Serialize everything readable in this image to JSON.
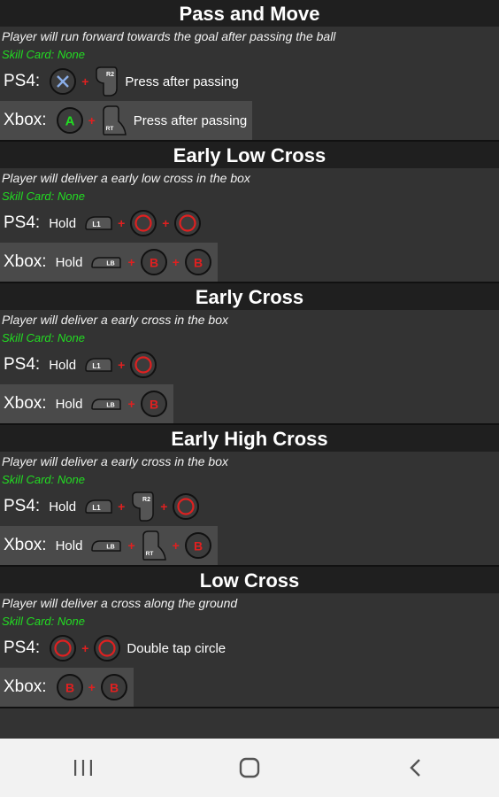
{
  "colors": {
    "accent_red": "#e02020",
    "skill_green": "#22dd22",
    "header_bg": "#1f1f1f",
    "body_bg": "#333333",
    "xbox_row_bg": "#4a4a4a"
  },
  "sections": [
    {
      "title": "Pass and Move",
      "description": "Player will run forward towards the goal after passing the ball",
      "skill": "Skill Card: None",
      "ps4": {
        "label": "PS4:",
        "hold": "",
        "buttons": [
          "cross-icon",
          "r2-trigger-icon"
        ],
        "text": "Press after passing"
      },
      "xbox": {
        "label": "Xbox:",
        "hold": "",
        "buttons": [
          "a-button-icon",
          "rt-trigger-icon"
        ],
        "text": "Press after passing"
      }
    },
    {
      "title": "Early Low Cross",
      "description": "Player will deliver a early low cross in the box",
      "skill": "Skill Card: None",
      "ps4": {
        "label": "PS4:",
        "hold": "Hold",
        "buttons": [
          "l1-bumper-icon",
          "circle-icon",
          "circle-icon"
        ],
        "text": ""
      },
      "xbox": {
        "label": "Xbox:",
        "hold": "Hold",
        "buttons": [
          "lb-bumper-icon",
          "b-button-icon",
          "b-button-icon"
        ],
        "text": ""
      }
    },
    {
      "title": "Early Cross",
      "description": "Player will deliver a early cross in the box",
      "skill": "Skill Card: None",
      "ps4": {
        "label": "PS4:",
        "hold": "Hold",
        "buttons": [
          "l1-bumper-icon",
          "circle-icon"
        ],
        "text": ""
      },
      "xbox": {
        "label": "Xbox:",
        "hold": "Hold",
        "buttons": [
          "lb-bumper-icon",
          "b-button-icon"
        ],
        "text": ""
      }
    },
    {
      "title": "Early High Cross",
      "description": "Player will deliver a early cross in the box",
      "skill": "Skill Card: None",
      "ps4": {
        "label": "PS4:",
        "hold": "Hold",
        "buttons": [
          "l1-bumper-icon",
          "r2-trigger-icon",
          "circle-icon"
        ],
        "text": ""
      },
      "xbox": {
        "label": "Xbox:",
        "hold": "Hold",
        "buttons": [
          "lb-bumper-icon",
          "rt-trigger-icon",
          "b-button-icon"
        ],
        "text": ""
      }
    },
    {
      "title": "Low Cross",
      "description": "Player will deliver a cross along the ground",
      "skill": "Skill Card: None",
      "ps4": {
        "label": "PS4:",
        "hold": "",
        "buttons": [
          "circle-icon",
          "circle-icon"
        ],
        "text": "Double tap circle"
      },
      "xbox": {
        "label": "Xbox:",
        "hold": "",
        "buttons": [
          "b-button-icon",
          "b-button-icon"
        ],
        "text": ""
      }
    }
  ],
  "navbar": {
    "buttons": [
      "recent-apps-icon",
      "home-icon",
      "back-icon"
    ]
  }
}
